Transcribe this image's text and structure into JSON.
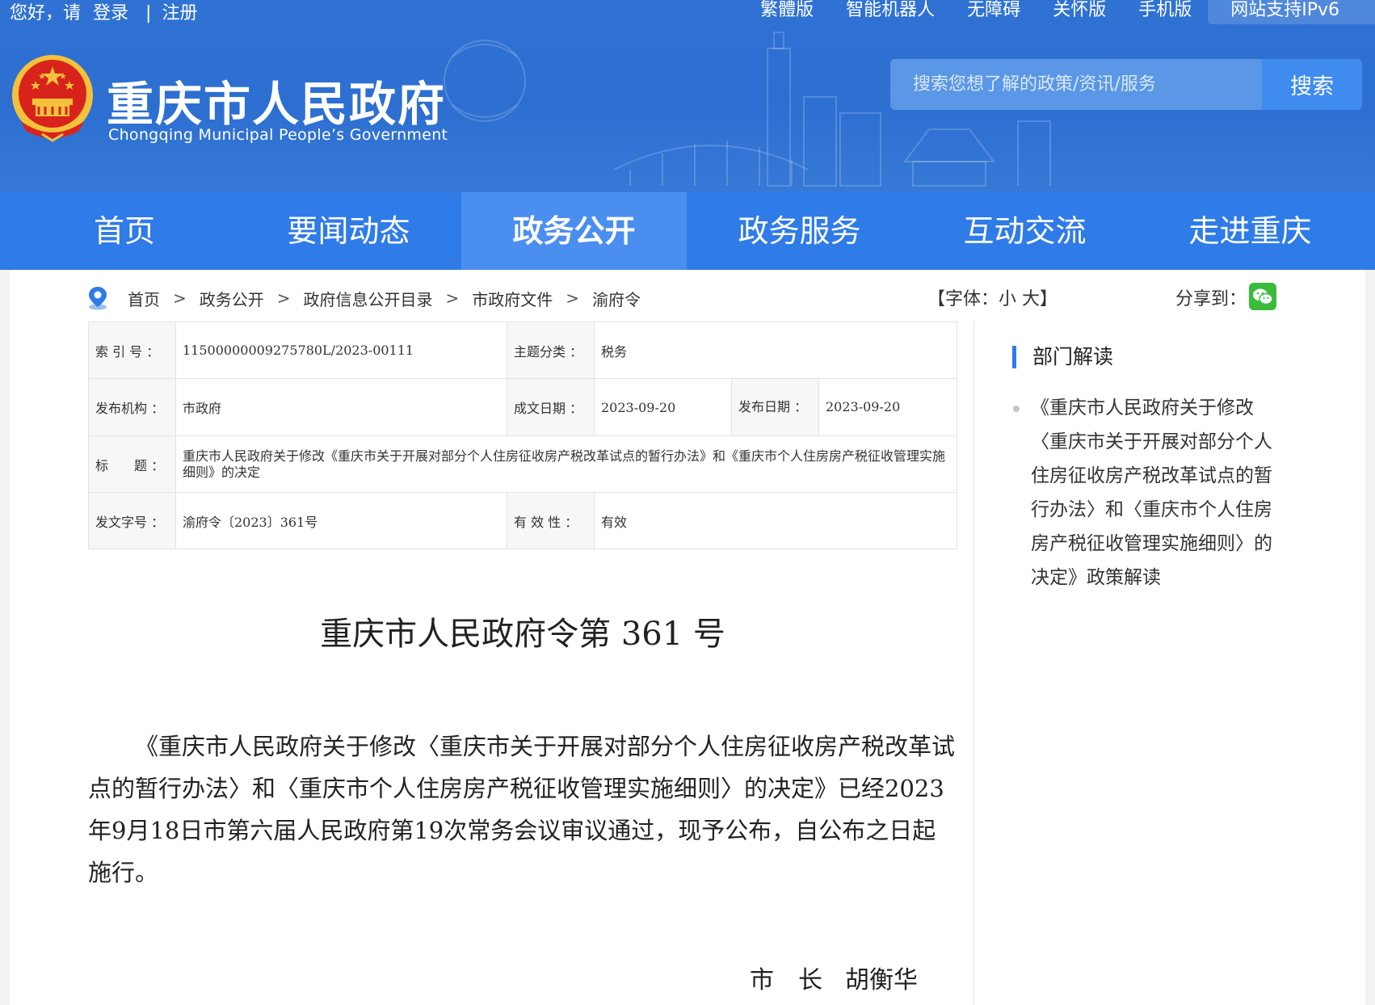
{
  "topbar": {
    "greeting": "您好，请",
    "login": "登录",
    "divider": "|",
    "register": "注册",
    "links": [
      "繁體版",
      "智能机器人",
      "无障碍",
      "关怀版",
      "手机版",
      "网站支持IPv6"
    ]
  },
  "site": {
    "name_cn": "重庆市人民政府",
    "name_en": "Chongqing Municipal People’s Government"
  },
  "search": {
    "placeholder": "搜索您想了解的政策/资讯/服务",
    "button": "搜索"
  },
  "nav": {
    "items": [
      "首页",
      "要闻动态",
      "政务公开",
      "政务服务",
      "互动交流",
      "走进重庆"
    ],
    "active_index": 2
  },
  "breadcrumb": {
    "items": [
      "首页",
      "政务公开",
      "政府信息公开目录",
      "市政府文件",
      "渝府令"
    ],
    "separator": ">"
  },
  "font_size": {
    "open": "【字体：",
    "small": "小",
    "large": "大",
    "close": "】"
  },
  "share": {
    "label": "分享到："
  },
  "meta": {
    "index_label": "索 引 号 ：",
    "index_value": "11500000009275780L/2023-00111",
    "topic_label": "主题分类 ：",
    "topic_value": "税务",
    "issuer_label": "发布机构 ：",
    "issuer_value": "市政府",
    "written_label": "成文日期 ：",
    "written_value": "2023-09-20",
    "published_label": "发布日期 ：",
    "published_value": "2023-09-20",
    "title_label": "标　　题 ：",
    "title_value": "重庆市人民政府关于修改《重庆市关于开展对部分个人住房征收房产税改革试点的暂行办法》和《重庆市个人住房房产税征收管理实施细则》的决定",
    "docno_label": "发文字号 ：",
    "docno_value": "渝府令〔2023〕361号",
    "validity_label": "有 效 性 ：",
    "validity_value": "有效"
  },
  "document": {
    "title": "重庆市人民政府令第 361 号",
    "body": "《重庆市人民政府关于修改〈重庆市关于开展对部分个人住房征收房产税改革试点的暂行办法〉和〈重庆市个人住房房产税征收管理实施细则〉的决定》已经2023年9月18日市第六届人民政府第19次常务会议审议通过，现予公布，自公布之日起施行。",
    "signer_role": "市　长",
    "signer_name": "胡衡华"
  },
  "sidebar": {
    "heading": "部门解读",
    "items": [
      "《重庆市人民政府关于修改〈重庆市关于开展对部分个人住房征收房产税改革试点的暂行办法〉和〈重庆市个人住房房产税征收管理实施细则〉的决定》政策解读"
    ]
  },
  "colors": {
    "header_blue": "#2f72d4",
    "nav_blue": "#2f7be8",
    "nav_active": "#4a8ef0",
    "wechat_green": "#3bbb3b",
    "emblem_red": "#d8231c",
    "emblem_gold": "#f3c23a"
  },
  "icons": {
    "location": "location-pin-icon",
    "wechat": "wechat-icon",
    "emblem": "national-emblem-icon"
  }
}
